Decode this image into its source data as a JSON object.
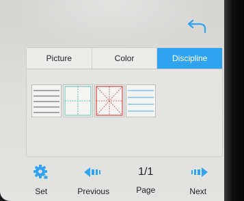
{
  "tabs": [
    {
      "label": "Picture",
      "active": false
    },
    {
      "label": "Color",
      "active": false
    },
    {
      "label": "Discipline",
      "active": true
    }
  ],
  "tiles": [
    {
      "name": "horizontal-lines-template"
    },
    {
      "name": "four-square-grid-template"
    },
    {
      "name": "rice-character-grid-template"
    },
    {
      "name": "blue-ruled-lines-template"
    }
  ],
  "bottom_bar": {
    "set_label": "Set",
    "previous_label": "Previous",
    "page_count": "1/1",
    "page_label": "Page",
    "next_label": "Next"
  },
  "icons": {
    "back": "return-arrow-icon",
    "set": "gear-icon",
    "previous": "left-arrow-icon",
    "next": "right-arrow-icon"
  },
  "colors": {
    "accent": "#2fa3ee",
    "grid_red": "#d04040",
    "grid_teal": "#5fbcb4",
    "grid_blue": "#4aa8e8"
  }
}
